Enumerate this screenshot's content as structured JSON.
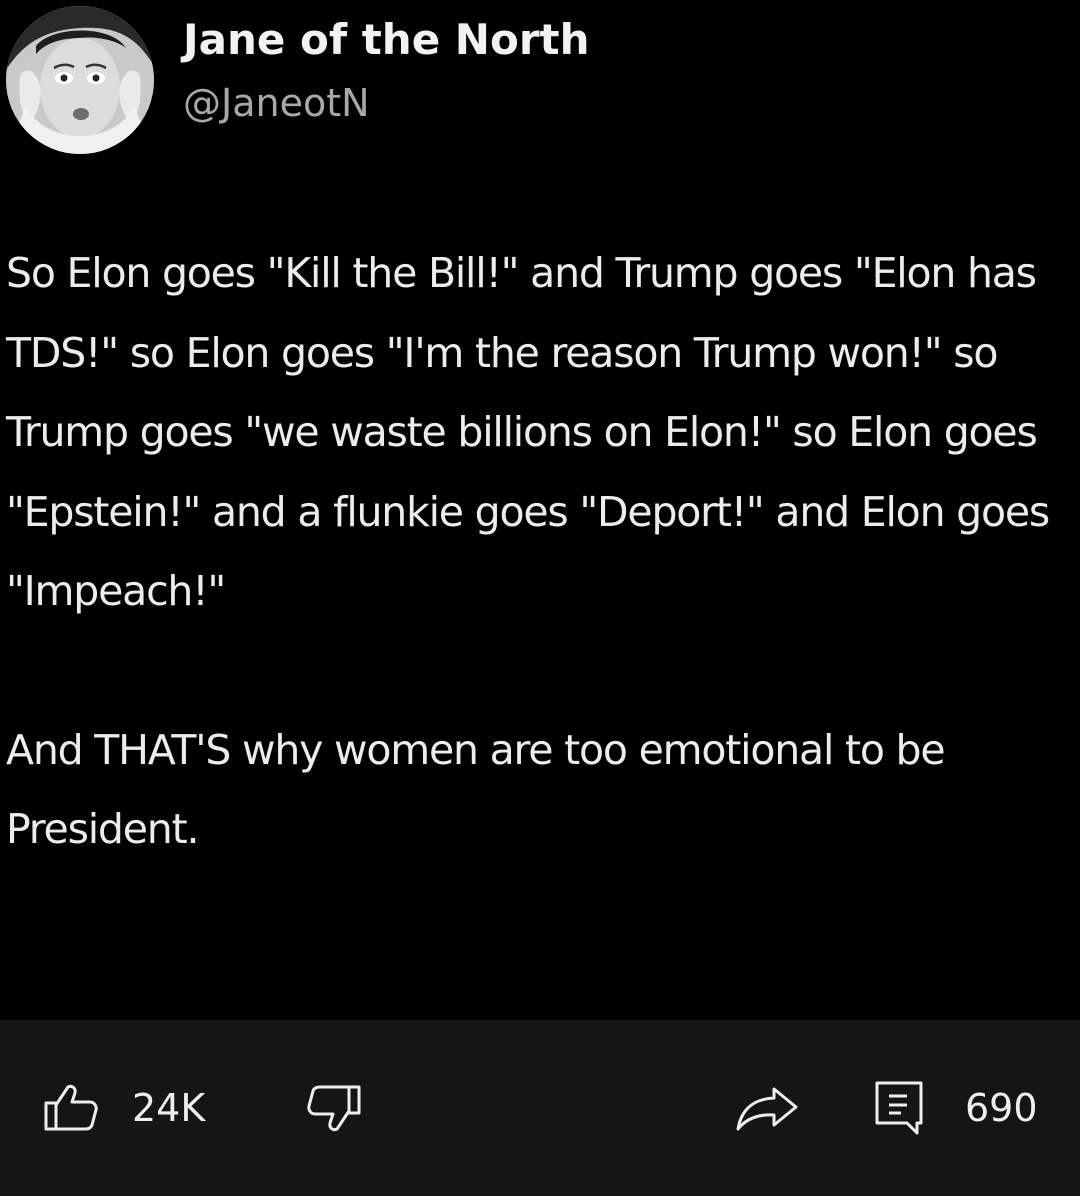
{
  "post": {
    "author": {
      "display_name": "Jane of the North",
      "handle": "@JaneotN"
    },
    "paragraphs": [
      "So Elon goes \"Kill the Bill!\" and Trump goes \"Elon has TDS!\" so Elon goes \"I'm the reason Trump won!\" so Trump goes \"we waste billions on Elon!\" so Elon goes \"Epstein!\" and a flunkie goes \"Deport!\" and Elon goes \"Impeach!\"",
      "And THAT'S why women are too emotional to be President."
    ]
  },
  "actions": {
    "likes": "24K",
    "comments": "690",
    "icons": [
      "thumbs-up-icon",
      "thumbs-down-icon",
      "share-icon",
      "comment-icon"
    ]
  },
  "colors": {
    "background": "#000000",
    "action_bar": "#151515",
    "text": "#ececec",
    "handle": "#a8a8a8"
  }
}
